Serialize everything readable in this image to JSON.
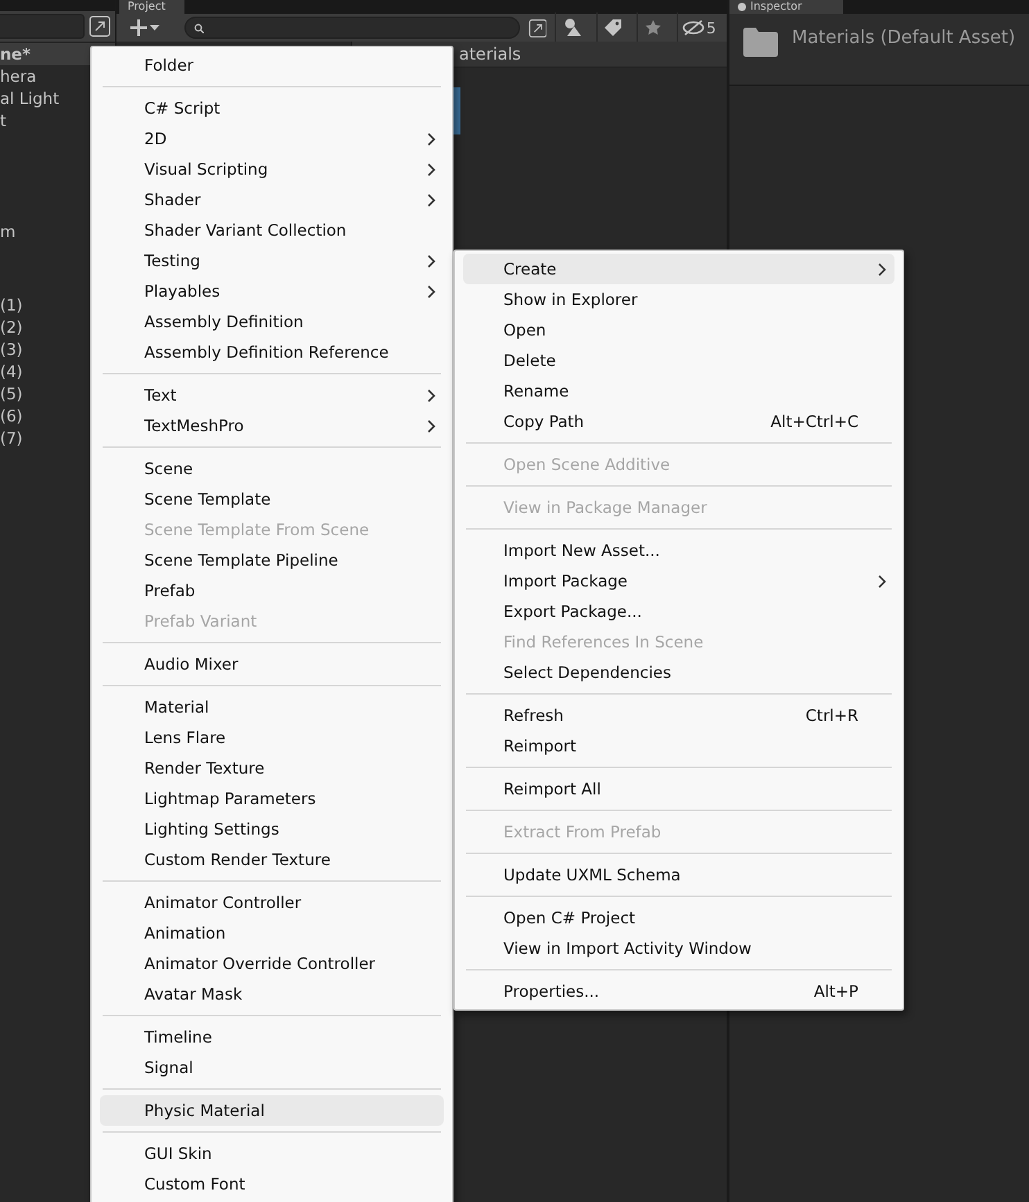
{
  "hierarchy": {
    "header": "ne*",
    "rows": [
      "hera",
      "al Light",
      "t",
      "m",
      "(1)",
      "(2)",
      "(3)",
      "(4)",
      "(5)",
      "(6)",
      "(7)"
    ]
  },
  "project": {
    "tab": "Project",
    "breadcrumb": "aterials",
    "hidden_count": "5"
  },
  "inspector": {
    "tab": "Inspector",
    "title": "Materials (Default Asset)"
  },
  "menus": [
    {
      "items": [
        {
          "kind": "item",
          "label": "Folder",
          "submenu": false,
          "disabled": false,
          "selected": false
        },
        {
          "kind": "separator"
        },
        {
          "kind": "item",
          "label": "C# Script",
          "submenu": false,
          "disabled": false,
          "selected": false
        },
        {
          "kind": "item",
          "label": "2D",
          "submenu": true,
          "disabled": false,
          "selected": false
        },
        {
          "kind": "item",
          "label": "Visual Scripting",
          "submenu": true,
          "disabled": false,
          "selected": false
        },
        {
          "kind": "item",
          "label": "Shader",
          "submenu": true,
          "disabled": false,
          "selected": false
        },
        {
          "kind": "item",
          "label": "Shader Variant Collection",
          "submenu": false,
          "disabled": false,
          "selected": false
        },
        {
          "kind": "item",
          "label": "Testing",
          "submenu": true,
          "disabled": false,
          "selected": false
        },
        {
          "kind": "item",
          "label": "Playables",
          "submenu": true,
          "disabled": false,
          "selected": false
        },
        {
          "kind": "item",
          "label": "Assembly Definition",
          "submenu": false,
          "disabled": false,
          "selected": false
        },
        {
          "kind": "item",
          "label": "Assembly Definition Reference",
          "submenu": false,
          "disabled": false,
          "selected": false
        },
        {
          "kind": "separator"
        },
        {
          "kind": "item",
          "label": "Text",
          "submenu": true,
          "disabled": false,
          "selected": false
        },
        {
          "kind": "item",
          "label": "TextMeshPro",
          "submenu": true,
          "disabled": false,
          "selected": false
        },
        {
          "kind": "separator"
        },
        {
          "kind": "item",
          "label": "Scene",
          "submenu": false,
          "disabled": false,
          "selected": false
        },
        {
          "kind": "item",
          "label": "Scene Template",
          "submenu": false,
          "disabled": false,
          "selected": false
        },
        {
          "kind": "item",
          "label": "Scene Template From Scene",
          "submenu": false,
          "disabled": true,
          "selected": false
        },
        {
          "kind": "item",
          "label": "Scene Template Pipeline",
          "submenu": false,
          "disabled": false,
          "selected": false
        },
        {
          "kind": "item",
          "label": "Prefab",
          "submenu": false,
          "disabled": false,
          "selected": false
        },
        {
          "kind": "item",
          "label": "Prefab Variant",
          "submenu": false,
          "disabled": true,
          "selected": false
        },
        {
          "kind": "separator"
        },
        {
          "kind": "item",
          "label": "Audio Mixer",
          "submenu": false,
          "disabled": false,
          "selected": false
        },
        {
          "kind": "separator"
        },
        {
          "kind": "item",
          "label": "Material",
          "submenu": false,
          "disabled": false,
          "selected": false
        },
        {
          "kind": "item",
          "label": "Lens Flare",
          "submenu": false,
          "disabled": false,
          "selected": false
        },
        {
          "kind": "item",
          "label": "Render Texture",
          "submenu": false,
          "disabled": false,
          "selected": false
        },
        {
          "kind": "item",
          "label": "Lightmap Parameters",
          "submenu": false,
          "disabled": false,
          "selected": false
        },
        {
          "kind": "item",
          "label": "Lighting Settings",
          "submenu": false,
          "disabled": false,
          "selected": false
        },
        {
          "kind": "item",
          "label": "Custom Render Texture",
          "submenu": false,
          "disabled": false,
          "selected": false
        },
        {
          "kind": "separator"
        },
        {
          "kind": "item",
          "label": "Animator Controller",
          "submenu": false,
          "disabled": false,
          "selected": false
        },
        {
          "kind": "item",
          "label": "Animation",
          "submenu": false,
          "disabled": false,
          "selected": false
        },
        {
          "kind": "item",
          "label": "Animator Override Controller",
          "submenu": false,
          "disabled": false,
          "selected": false
        },
        {
          "kind": "item",
          "label": "Avatar Mask",
          "submenu": false,
          "disabled": false,
          "selected": false
        },
        {
          "kind": "separator"
        },
        {
          "kind": "item",
          "label": "Timeline",
          "submenu": false,
          "disabled": false,
          "selected": false
        },
        {
          "kind": "item",
          "label": "Signal",
          "submenu": false,
          "disabled": false,
          "selected": false
        },
        {
          "kind": "separator"
        },
        {
          "kind": "item",
          "label": "Physic Material",
          "submenu": false,
          "disabled": false,
          "selected": true
        },
        {
          "kind": "separator"
        },
        {
          "kind": "item",
          "label": "GUI Skin",
          "submenu": false,
          "disabled": false,
          "selected": false
        },
        {
          "kind": "item",
          "label": "Custom Font",
          "submenu": false,
          "disabled": false,
          "selected": false
        }
      ]
    },
    {
      "items": [
        {
          "kind": "item",
          "label": "Create",
          "submenu": true,
          "disabled": false,
          "selected": true
        },
        {
          "kind": "item",
          "label": "Show in Explorer",
          "submenu": false,
          "disabled": false,
          "selected": false
        },
        {
          "kind": "item",
          "label": "Open",
          "submenu": false,
          "disabled": false,
          "selected": false
        },
        {
          "kind": "item",
          "label": "Delete",
          "submenu": false,
          "disabled": false,
          "selected": false
        },
        {
          "kind": "item",
          "label": "Rename",
          "submenu": false,
          "disabled": false,
          "selected": false
        },
        {
          "kind": "item",
          "label": "Copy Path",
          "shortcut": "Alt+Ctrl+C",
          "submenu": false,
          "disabled": false,
          "selected": false
        },
        {
          "kind": "separator"
        },
        {
          "kind": "item",
          "label": "Open Scene Additive",
          "submenu": false,
          "disabled": true,
          "selected": false
        },
        {
          "kind": "separator"
        },
        {
          "kind": "item",
          "label": "View in Package Manager",
          "submenu": false,
          "disabled": true,
          "selected": false
        },
        {
          "kind": "separator"
        },
        {
          "kind": "item",
          "label": "Import New Asset...",
          "submenu": false,
          "disabled": false,
          "selected": false
        },
        {
          "kind": "item",
          "label": "Import Package",
          "submenu": true,
          "disabled": false,
          "selected": false
        },
        {
          "kind": "item",
          "label": "Export Package...",
          "submenu": false,
          "disabled": false,
          "selected": false
        },
        {
          "kind": "item",
          "label": "Find References In Scene",
          "submenu": false,
          "disabled": true,
          "selected": false
        },
        {
          "kind": "item",
          "label": "Select Dependencies",
          "submenu": false,
          "disabled": false,
          "selected": false
        },
        {
          "kind": "separator"
        },
        {
          "kind": "item",
          "label": "Refresh",
          "shortcut": "Ctrl+R",
          "submenu": false,
          "disabled": false,
          "selected": false
        },
        {
          "kind": "item",
          "label": "Reimport",
          "submenu": false,
          "disabled": false,
          "selected": false
        },
        {
          "kind": "separator"
        },
        {
          "kind": "item",
          "label": "Reimport All",
          "submenu": false,
          "disabled": false,
          "selected": false
        },
        {
          "kind": "separator"
        },
        {
          "kind": "item",
          "label": "Extract From Prefab",
          "submenu": false,
          "disabled": true,
          "selected": false
        },
        {
          "kind": "separator"
        },
        {
          "kind": "item",
          "label": "Update UXML Schema",
          "submenu": false,
          "disabled": false,
          "selected": false
        },
        {
          "kind": "separator"
        },
        {
          "kind": "item",
          "label": "Open C# Project",
          "submenu": false,
          "disabled": false,
          "selected": false
        },
        {
          "kind": "item",
          "label": "View in Import Activity Window",
          "submenu": false,
          "disabled": false,
          "selected": false
        },
        {
          "kind": "separator"
        },
        {
          "kind": "item",
          "label": "Properties...",
          "shortcut": "Alt+P",
          "submenu": false,
          "disabled": false,
          "selected": false
        }
      ]
    }
  ]
}
